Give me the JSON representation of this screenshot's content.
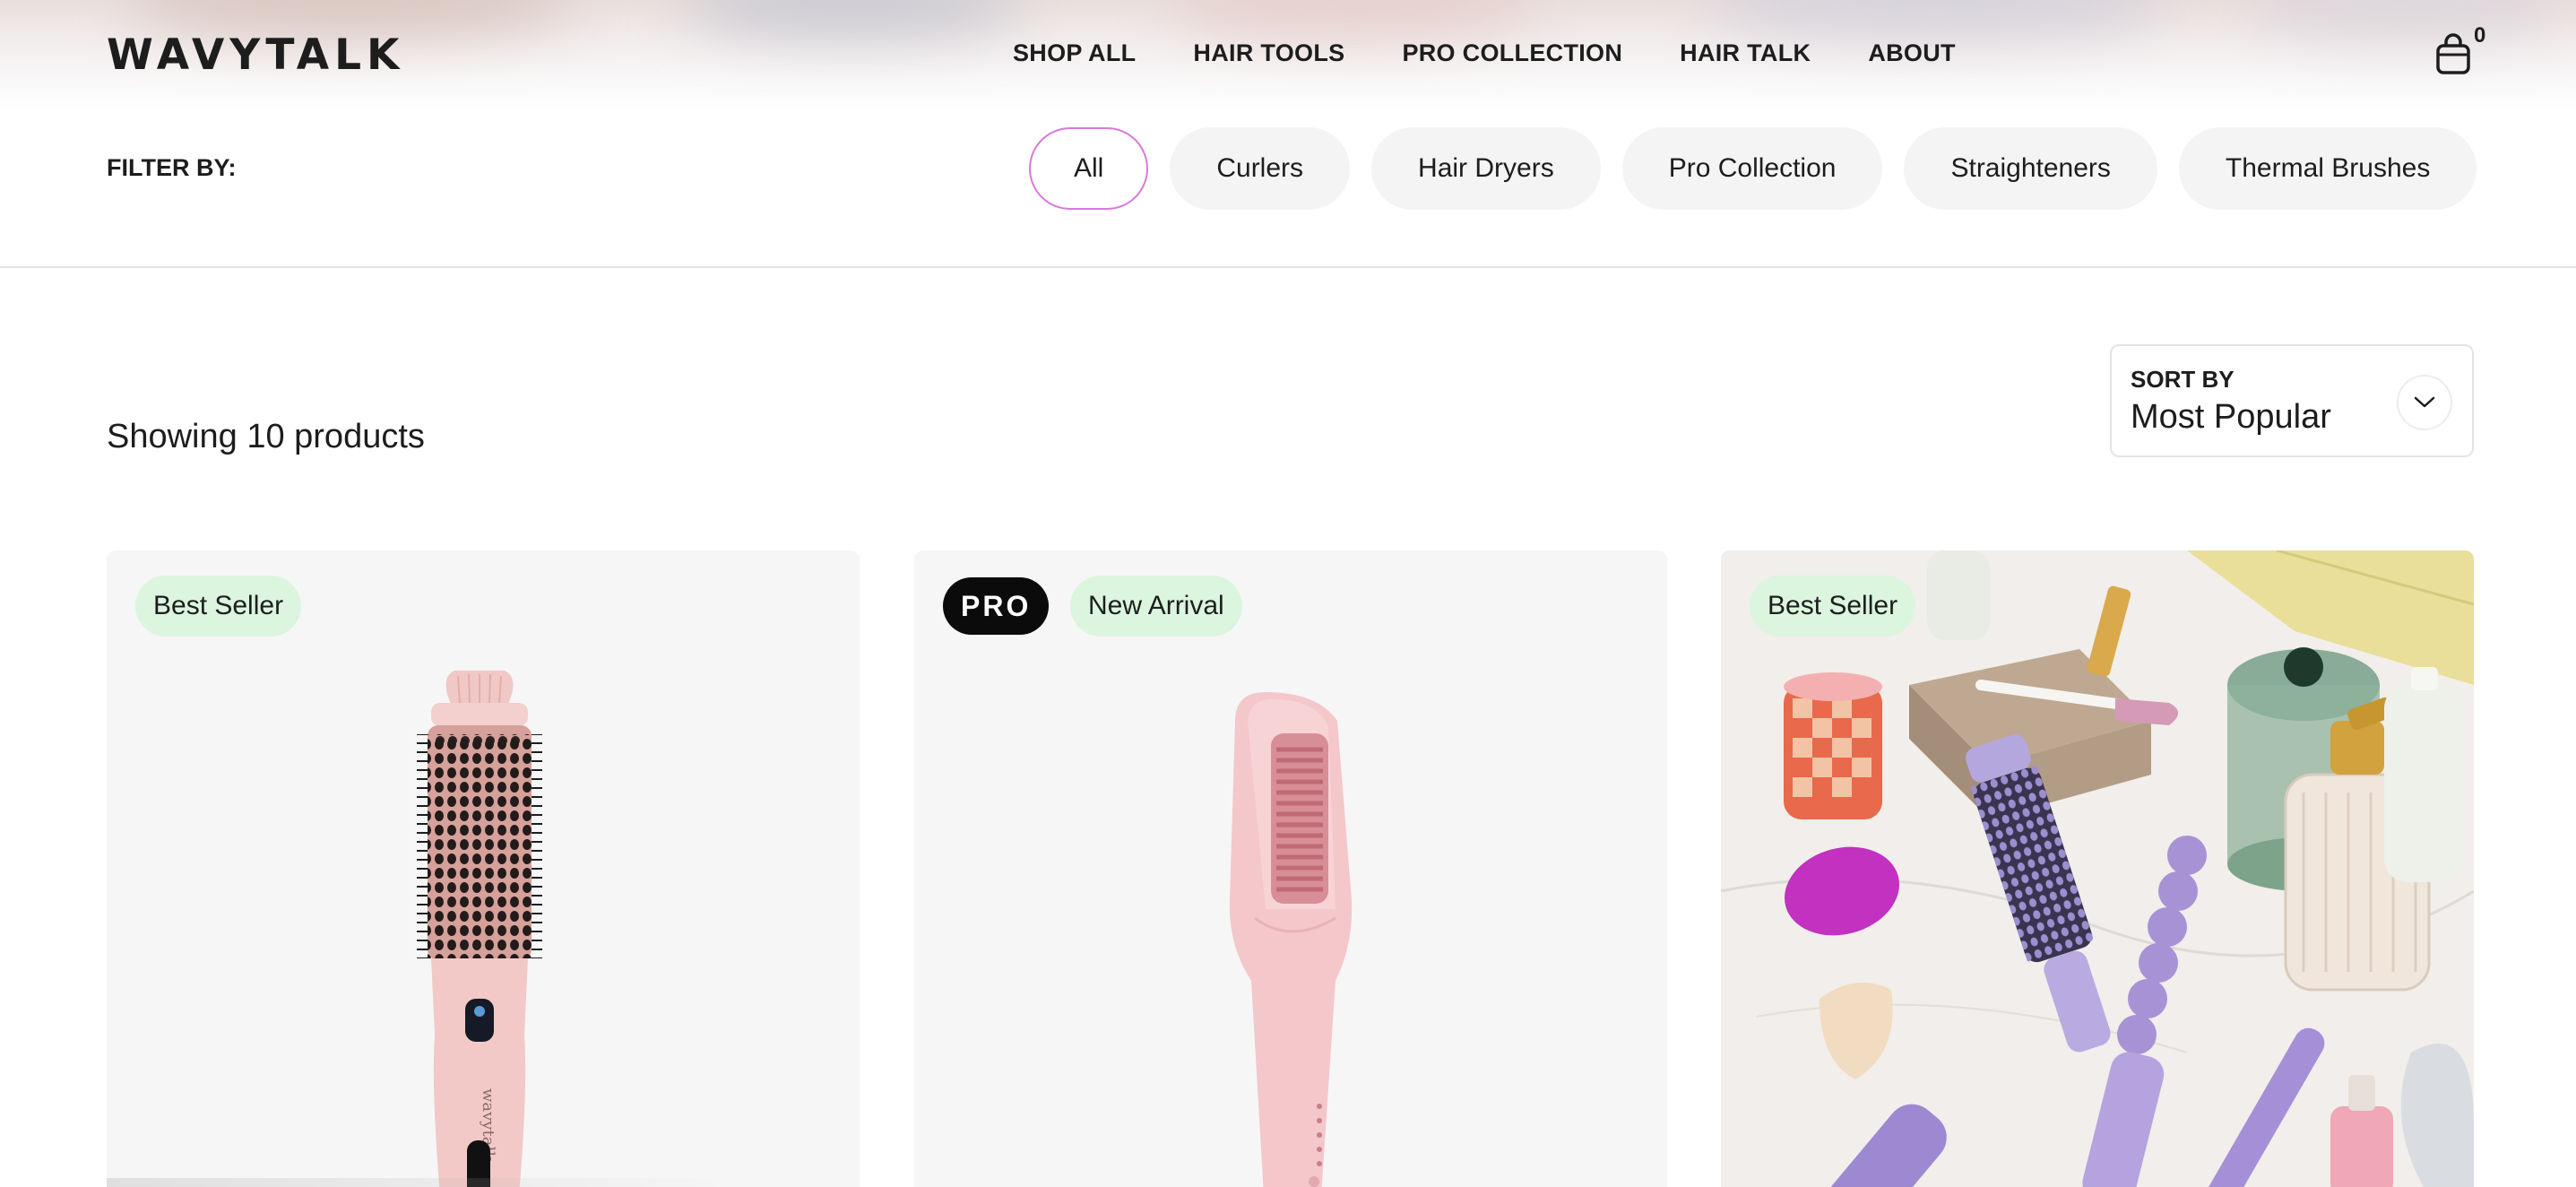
{
  "header": {
    "logo": "WAVYTALK",
    "nav": [
      "SHOP ALL",
      "HAIR TOOLS",
      "PRO COLLECTION",
      "HAIR TALK",
      "ABOUT"
    ],
    "cart_count": "0",
    "cart_icon": "shopping-bag-icon"
  },
  "filter": {
    "label": "FILTER BY:",
    "options": [
      "All",
      "Curlers",
      "Hair Dryers",
      "Pro Collection",
      "Straighteners",
      "Thermal Brushes"
    ],
    "selected": "All",
    "active_border_color": "#d77ad8"
  },
  "listing": {
    "showing_text": "Showing 10 products"
  },
  "sort": {
    "label": "SORT BY",
    "value": "Most Popular",
    "icon": "chevron-down-icon"
  },
  "products": [
    {
      "badges": [
        "Best Seller"
      ],
      "pro": false,
      "image": "pink thermal round brush"
    },
    {
      "badges": [
        "New Arrival"
      ],
      "pro": true,
      "pro_label": "PRO",
      "image": "pink straightening brush"
    },
    {
      "badges": [
        "Best Seller"
      ],
      "pro": false,
      "image": "lavender styling tools lifestyle flat lay"
    }
  ],
  "colors": {
    "badge_green": "#dbf5df",
    "chip_gray": "#f4f4f4",
    "text": "#1d1d1d"
  }
}
